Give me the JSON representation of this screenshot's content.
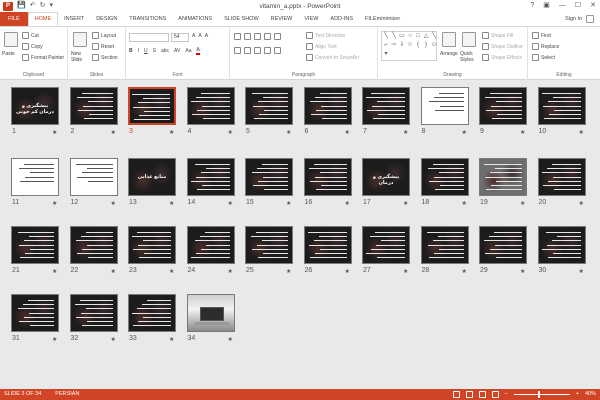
{
  "titlebar": {
    "title": "vitamin_a.pptx - PowerPoint",
    "app_icon": "P",
    "qat": {
      "save": "💾",
      "undo": "↶",
      "redo": "↻",
      "customize": "▾"
    },
    "controls": {
      "help": "?",
      "ribbon": "▣",
      "minimize": "—",
      "maximize": "☐",
      "close": "✕"
    }
  },
  "tabs": [
    "FILE",
    "HOME",
    "INSERT",
    "DESIGN",
    "TRANSITIONS",
    "ANIMATIONS",
    "SLIDE SHOW",
    "REVIEW",
    "VIEW",
    "ADD-INS",
    "FILEminimizer"
  ],
  "active_tab": "HOME",
  "signin": "Sign in",
  "ribbon": {
    "clipboard": {
      "paste": "Paste",
      "cut": "Cut",
      "copy": "Copy",
      "format_painter": "Format Painter",
      "label": "Clipboard"
    },
    "slides": {
      "new_slide": "New Slide",
      "layout": "Layout",
      "reset": "Reset",
      "section": "Section",
      "label": "Slides"
    },
    "font": {
      "font_size": "54",
      "label": "Font",
      "grow": "A",
      "shrink": "A",
      "clear": "A",
      "bold": "B",
      "italic": "I",
      "underline": "U",
      "shadow": "S",
      "strike": "abc",
      "spacing": "AV",
      "case": "Aa",
      "color": "A"
    },
    "paragraph": {
      "text_direction": "Text Direction",
      "align_text": "Align Text",
      "smartart": "Convert to SmartArt",
      "label": "Paragraph"
    },
    "drawing": {
      "arrange": "Arrange",
      "quick_styles": "Quick Styles",
      "shape_fill": "Shape Fill",
      "shape_outline": "Shape Outline",
      "shape_effects": "Shape Effects",
      "label": "Drawing"
    },
    "editing": {
      "find": "Find",
      "replace": "Replace",
      "select": "Select",
      "label": "Editing"
    }
  },
  "slides": [
    {
      "n": "1",
      "kind": "title",
      "text": "پیشگیری و درمان کم خونی"
    },
    {
      "n": "2",
      "kind": "text"
    },
    {
      "n": "3",
      "kind": "text",
      "selected": true
    },
    {
      "n": "4",
      "kind": "text"
    },
    {
      "n": "5",
      "kind": "text"
    },
    {
      "n": "6",
      "kind": "text"
    },
    {
      "n": "7",
      "kind": "text"
    },
    {
      "n": "8",
      "kind": "light"
    },
    {
      "n": "9",
      "kind": "text"
    },
    {
      "n": "10",
      "kind": "text"
    },
    {
      "n": "11",
      "kind": "light"
    },
    {
      "n": "12",
      "kind": "light"
    },
    {
      "n": "13",
      "kind": "title",
      "text": "منابع غذایی"
    },
    {
      "n": "14",
      "kind": "text"
    },
    {
      "n": "15",
      "kind": "text"
    },
    {
      "n": "16",
      "kind": "text"
    },
    {
      "n": "17",
      "kind": "title",
      "text": "پیشگیری و درمان"
    },
    {
      "n": "18",
      "kind": "text"
    },
    {
      "n": "19",
      "kind": "grey"
    },
    {
      "n": "20",
      "kind": "text"
    },
    {
      "n": "21",
      "kind": "text"
    },
    {
      "n": "22",
      "kind": "text"
    },
    {
      "n": "23",
      "kind": "text"
    },
    {
      "n": "24",
      "kind": "text"
    },
    {
      "n": "25",
      "kind": "text"
    },
    {
      "n": "26",
      "kind": "text"
    },
    {
      "n": "27",
      "kind": "text"
    },
    {
      "n": "28",
      "kind": "text"
    },
    {
      "n": "29",
      "kind": "text"
    },
    {
      "n": "30",
      "kind": "text"
    },
    {
      "n": "31",
      "kind": "text"
    },
    {
      "n": "32",
      "kind": "text"
    },
    {
      "n": "33",
      "kind": "text"
    },
    {
      "n": "34",
      "kind": "photo"
    }
  ],
  "transition_marker": "★",
  "status": {
    "slide_info": "SLIDE 3 OF 34",
    "language": "PERSIAN",
    "zoom": "40%",
    "zoom_minus": "−",
    "zoom_plus": "+"
  }
}
